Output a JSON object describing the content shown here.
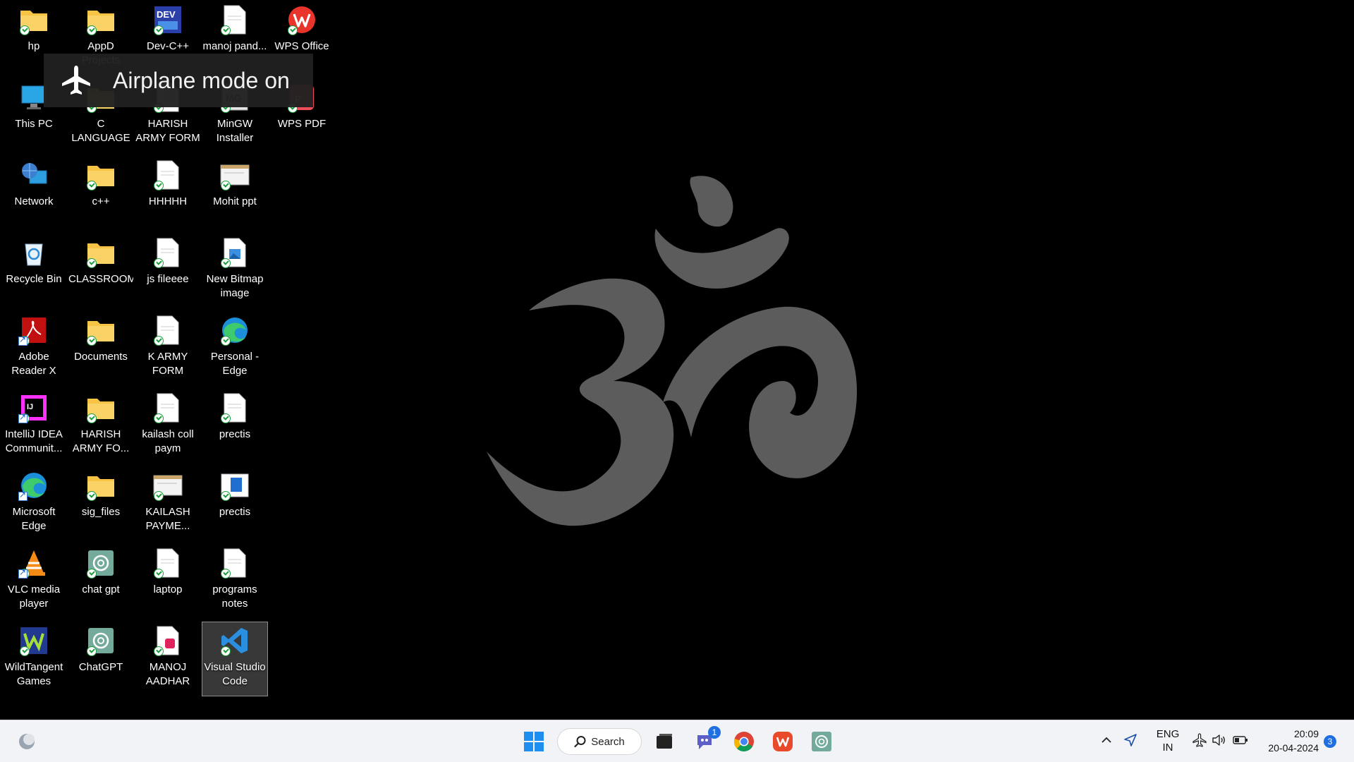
{
  "desktop": {
    "icons": [
      {
        "label": "hp",
        "type": "folder"
      },
      {
        "label": "This PC",
        "type": "thispc"
      },
      {
        "label": "Network",
        "type": "network"
      },
      {
        "label": "Recycle Bin",
        "type": "recycle"
      },
      {
        "label": "Adobe Reader X",
        "type": "adobe"
      },
      {
        "label": "IntelliJ IDEA Communit...",
        "type": "intellij"
      },
      {
        "label": "Microsoft Edge",
        "type": "edge"
      },
      {
        "label": "VLC media player",
        "type": "vlc"
      },
      {
        "label": "WildTangent Games",
        "type": "wildtangent"
      },
      {
        "label": "AppD Projects",
        "type": "folder"
      },
      {
        "label": "C LANGUAGE",
        "type": "folder"
      },
      {
        "label": "c++",
        "type": "folder"
      },
      {
        "label": "CLASSROOM",
        "type": "folder"
      },
      {
        "label": "Documents",
        "type": "folder"
      },
      {
        "label": "HARISH ARMY FO...",
        "type": "folder"
      },
      {
        "label": "sig_files",
        "type": "folder"
      },
      {
        "label": "chat gpt",
        "type": "chatgpt"
      },
      {
        "label": "ChatGPT",
        "type": "chatgpt"
      },
      {
        "label": "Dev-C++",
        "type": "devcpp"
      },
      {
        "label": "HARISH ARMY FORM",
        "type": "doc"
      },
      {
        "label": "HHHHH",
        "type": "doc"
      },
      {
        "label": "js fileeee",
        "type": "doc"
      },
      {
        "label": "K ARMY FORM",
        "type": "doc"
      },
      {
        "label": "kailash coll paym",
        "type": "doc"
      },
      {
        "label": "KAILASH PAYME...",
        "type": "screenshot"
      },
      {
        "label": "laptop",
        "type": "doc"
      },
      {
        "label": "MANOJ AADHAR",
        "type": "pdfdoc"
      },
      {
        "label": "manoj pand...",
        "type": "doc"
      },
      {
        "label": "MinGW Installer",
        "type": "mingw"
      },
      {
        "label": "Mohit ppt",
        "type": "screenshot"
      },
      {
        "label": "New Bitmap image",
        "type": "bitmap"
      },
      {
        "label": "Personal - Edge",
        "type": "edge"
      },
      {
        "label": "prectis",
        "type": "doc"
      },
      {
        "label": "prectis",
        "type": "docblue"
      },
      {
        "label": "programs notes",
        "type": "doc"
      },
      {
        "label": "Visual Studio Code",
        "type": "vscode",
        "selected": true
      },
      {
        "label": "WPS Office",
        "type": "wps"
      },
      {
        "label": "WPS PDF",
        "type": "wpspdf"
      }
    ],
    "colors": {
      "folder": "#f6c344",
      "accent": "#0078d4"
    }
  },
  "toast": {
    "text": "Airplane mode on",
    "icon": "airplane-icon"
  },
  "taskbar": {
    "search_label": "Search",
    "apps": [
      "start-icon",
      "search-icon",
      "file-explorer-icon",
      "teams-chat-icon",
      "chrome-icon",
      "wps-icon",
      "chatgpt-icon"
    ],
    "chat_badge": "1",
    "tray": {
      "lang_line1": "ENG",
      "lang_line2": "IN",
      "time": "20:09",
      "date": "20-04-2024",
      "notification_count": "3"
    }
  }
}
